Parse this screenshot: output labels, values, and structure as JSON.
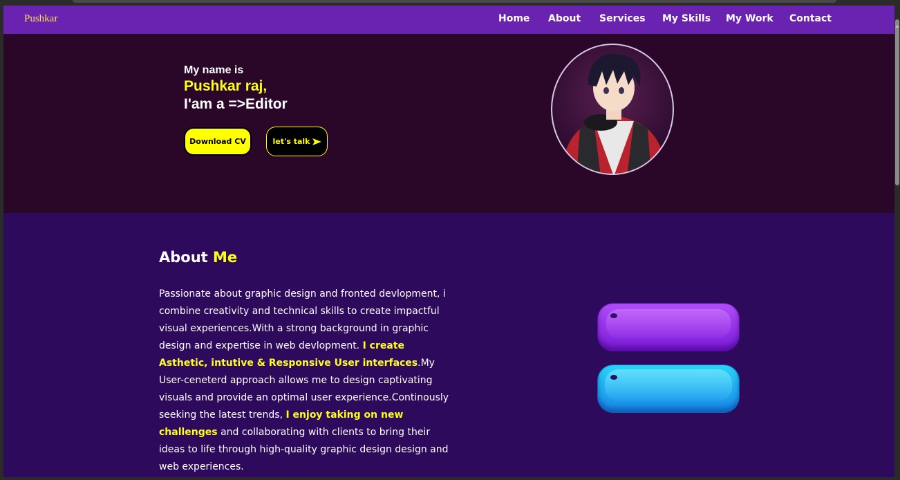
{
  "nav": {
    "logo": "Pushkar",
    "links": [
      "Home",
      "About",
      "Services",
      "My Skills",
      "My Work",
      "Contact"
    ]
  },
  "hero": {
    "intro": "My name is",
    "name": "Pushkar raj,",
    "role": "I'am a =>Editor",
    "download_label": "Download CV",
    "talk_label": "let's talk",
    "talk_icon": "send-arrow-icon"
  },
  "about": {
    "title_plain": "About",
    "title_highlight": "Me",
    "p1": "Passionate about graphic design and fronted devlopment, i combine creativity and technical skills to create impactful visual experiences.With a strong background in graphic design and expertise in web devlopment.",
    "hl1": "I create Asthetic, intutive & Responsive User interfaces",
    "p2": ".My User-ceneterd approach allows me to design captivating visuals and provide an optimal user experience.Continously seeking the latest trends,",
    "hl2": "I enjoy taking on new challenges",
    "p3": "and collaborating with clients to bring their ideas to life through high-quality graphic design design and web experiences."
  },
  "colors": {
    "nav_bg": "#6a22b0",
    "hero_bg": "#2a0628",
    "about_bg": "#2e0a5c",
    "accent": "#ffff1a"
  }
}
